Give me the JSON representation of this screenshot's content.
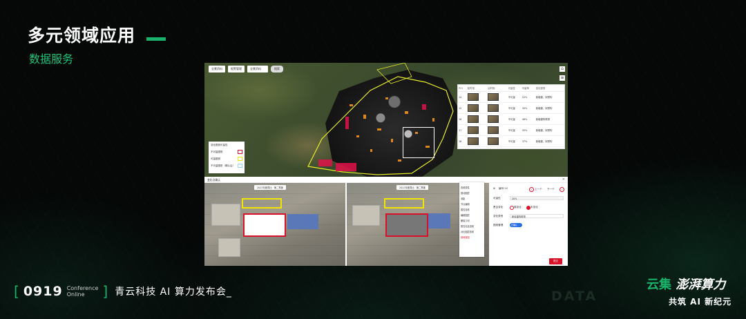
{
  "slide": {
    "title": "多元领域应用",
    "subtitle": "数据服务"
  },
  "map": {
    "toolbar": [
      {
        "label": "全景资料"
      },
      {
        "label": "报警管理"
      }
    ],
    "area_select": "全景资料",
    "toolbar_button": "搜索",
    "table": {
      "headers": [
        "POI",
        "前时相",
        "后时相",
        "可量性",
        "可量率",
        "变化类别"
      ],
      "rows": [
        {
          "poi": "14",
          "status": "不可量",
          "ratio": "20%",
          "type": "新增建、拟预构"
        },
        {
          "poi": "15",
          "status": "不可量",
          "ratio": "30%",
          "type": "新增建、拟预构"
        },
        {
          "poi": "16",
          "status": "不可量",
          "ratio": "48%",
          "type": "新增建构筑物"
        },
        {
          "poi": "17",
          "status": "不可量",
          "ratio": "35%",
          "type": "新增建、拟预构"
        },
        {
          "poi": "18",
          "status": "不可量",
          "ratio": "37%",
          "type": "新增建、拟预构"
        }
      ]
    },
    "legend": {
      "title": "变化图斑可量性",
      "items": [
        {
          "label": "不可量图斑",
          "color": "#d8102a"
        },
        {
          "label": "可量图斑",
          "color": "#f2e600"
        },
        {
          "label": "不可量图斑（确认后）",
          "color": "#8fd3ff"
        }
      ]
    }
  },
  "compare": {
    "header": "变化点确认",
    "left_select": "2023年度同比 · 第二季度",
    "right_select": "2022年度同比 · 第二季度",
    "context_menu": {
      "items": [
        "查看属性",
        "推动图层",
        "测距",
        "节点编辑",
        "属性查看",
        "编辑图层",
        "删除几何",
        "属性信息查看",
        "对比图层查看"
      ],
      "danger": "其他按钮"
    },
    "panel": {
      "id_label": "编号:20",
      "prev": "上一个",
      "next": "下一个",
      "fields": [
        {
          "label": "可量性",
          "value": "20%"
        },
        {
          "label": "变化类别",
          "value": "新增建构筑物"
        }
      ],
      "radio_label": "是否变化",
      "radio_options": [
        "属变化",
        "未变化"
      ],
      "toggle_label": "图斑管理",
      "toggle_value": "已确认",
      "confirm": "提交"
    }
  },
  "footer": {
    "code": "0919",
    "conf_line1": "Conference",
    "conf_line2": "Online",
    "event": "青云科技 AI 算力发布会_",
    "ghost": "DATA",
    "brand_1": "云集",
    "brand_2": "澎湃算力",
    "slogan": "共筑 AI 新纪元"
  },
  "colors": {
    "accent": "#19b36b",
    "danger": "#d8102a",
    "highlight": "#f2e600"
  }
}
